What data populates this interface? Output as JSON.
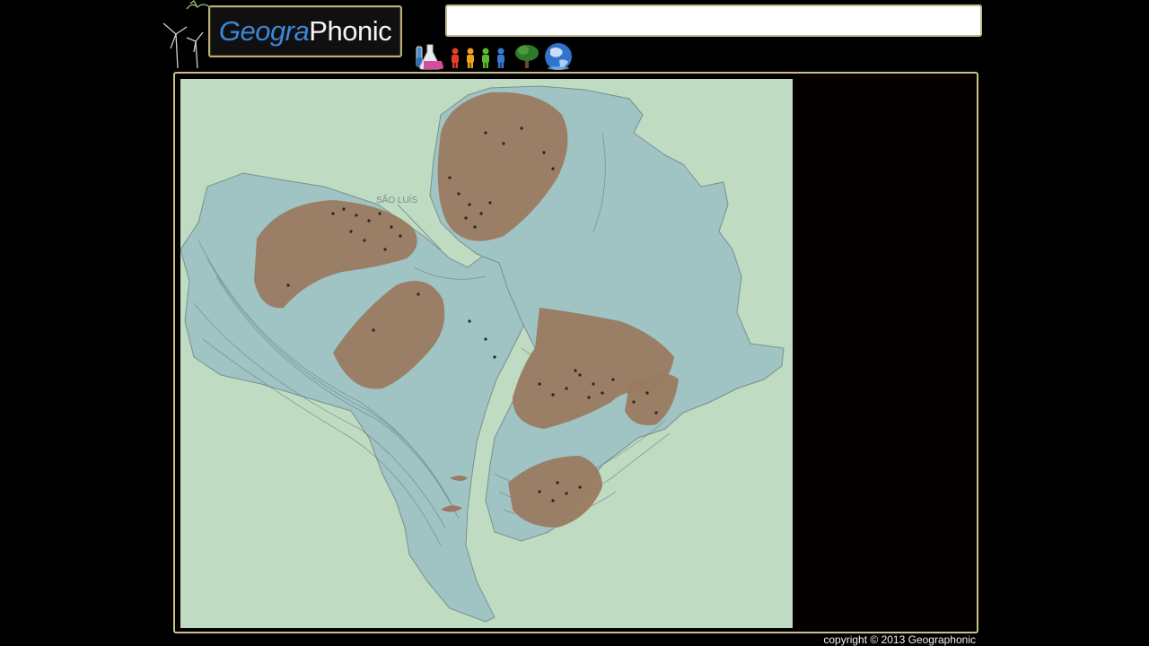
{
  "header": {
    "logo_part1": "Geogra",
    "logo_part2": "Phonic",
    "search_value": "",
    "icons": [
      "windmill-icon",
      "flask-icon",
      "people-icon",
      "tree-icon",
      "globe-icon"
    ]
  },
  "slide": {
    "map_label": "SÃO LUÍS"
  },
  "footer": {
    "copyright": "copyright © 2013 Geographonic"
  },
  "colors": {
    "frame": "#c9c08d",
    "background": "#000000",
    "map_background": "#bfdcc2",
    "continent_shelf": "#9fc4c3",
    "craton": "#9a7a60",
    "logo_blue": "#3c86d6"
  }
}
